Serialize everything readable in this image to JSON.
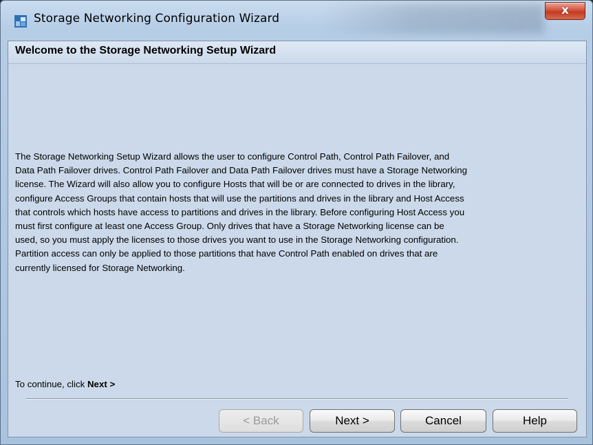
{
  "window": {
    "title": "Storage Networking Configuration Wizard",
    "close_label": "x"
  },
  "wizard": {
    "heading": "Welcome to the Storage Networking Setup Wizard",
    "body": [
      "The Storage Networking Setup Wizard allows the user to configure Control Path, Control Path Failover, and",
      "Data Path Failover drives. Control Path Failover and Data Path Failover drives must have a Storage Networking",
      "license. The Wizard will also allow you to configure Hosts that will be or are connected to drives in the library,",
      "configure Access Groups that contain hosts that will use the partitions and drives in the library and Host Access",
      "that controls which hosts have access to partitions and drives in the library. Before configuring Host Access you",
      "must first configure at least one Access Group. Only drives that have a Storage Networking license can be",
      "used, so you must apply the licenses to those drives you want to use in the Storage Networking configuration.",
      "Partition access can only be applied to those partitions that have Control Path enabled on drives that are",
      "currently licensed for Storage Networking."
    ],
    "hint_prefix": "To continue, click ",
    "hint_emphasis": "Next >"
  },
  "buttons": {
    "back": "< Back",
    "next": "Next >",
    "cancel": "Cancel",
    "help": "Help"
  },
  "colors": {
    "window_bg": "#b6cde6",
    "content_bg": "#cbd9ea",
    "close_button": "#c9442d",
    "app_icon": "#2f6fb5"
  },
  "icons": {
    "app": "wizard-app-icon",
    "close": "close-icon"
  }
}
